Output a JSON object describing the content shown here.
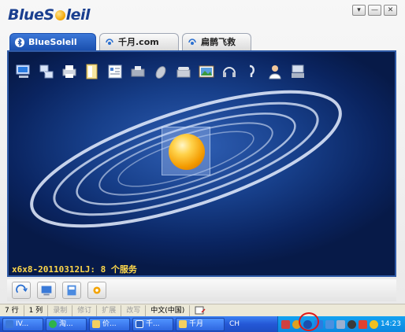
{
  "app": {
    "logo_text_a": "BlueS",
    "logo_text_b": "leil",
    "window_buttons": [
      "▾",
      "—",
      "✕"
    ]
  },
  "tabs": [
    {
      "label": "BlueSoleil",
      "active": true
    },
    {
      "label": "千月.com",
      "active": false
    },
    {
      "label": "扁鹊飞救",
      "active": false
    }
  ],
  "toolbar_icons": [
    "computer-icon",
    "network-icon",
    "printer-icon",
    "file-transfer-icon",
    "contacts-icon",
    "fax-icon",
    "mouse-icon",
    "phone-icon",
    "picture-icon",
    "headset-icon",
    "audio-gateway-icon",
    "person-icon",
    "lan-access-icon"
  ],
  "main": {
    "device_status": "x6x8-20110312LJ:  8 个服务"
  },
  "bottom_buttons": [
    "refresh-icon",
    "my-devices-icon",
    "services-icon",
    "settings-icon"
  ],
  "statusbar": {
    "row": "7 行",
    "col": "1 列",
    "record": "录制",
    "revise": "修订",
    "extend": "扩展",
    "overwrite": "改写",
    "language": "中文(中国)"
  },
  "taskbar": {
    "items": [
      {
        "label": "IV...",
        "icon": "bluetooth-icon"
      },
      {
        "label": "淘...",
        "icon": "browser-icon"
      },
      {
        "label": "价...",
        "icon": "folder-icon"
      },
      {
        "label": "千...",
        "icon": "word-icon"
      },
      {
        "label": "千月",
        "icon": "folder-icon"
      }
    ],
    "language_indicator": "CH",
    "clock": "14:23"
  },
  "colors": {
    "accent": "#1a4fae",
    "status_text": "#ffd84a",
    "highlight_circle": "#e01818"
  }
}
